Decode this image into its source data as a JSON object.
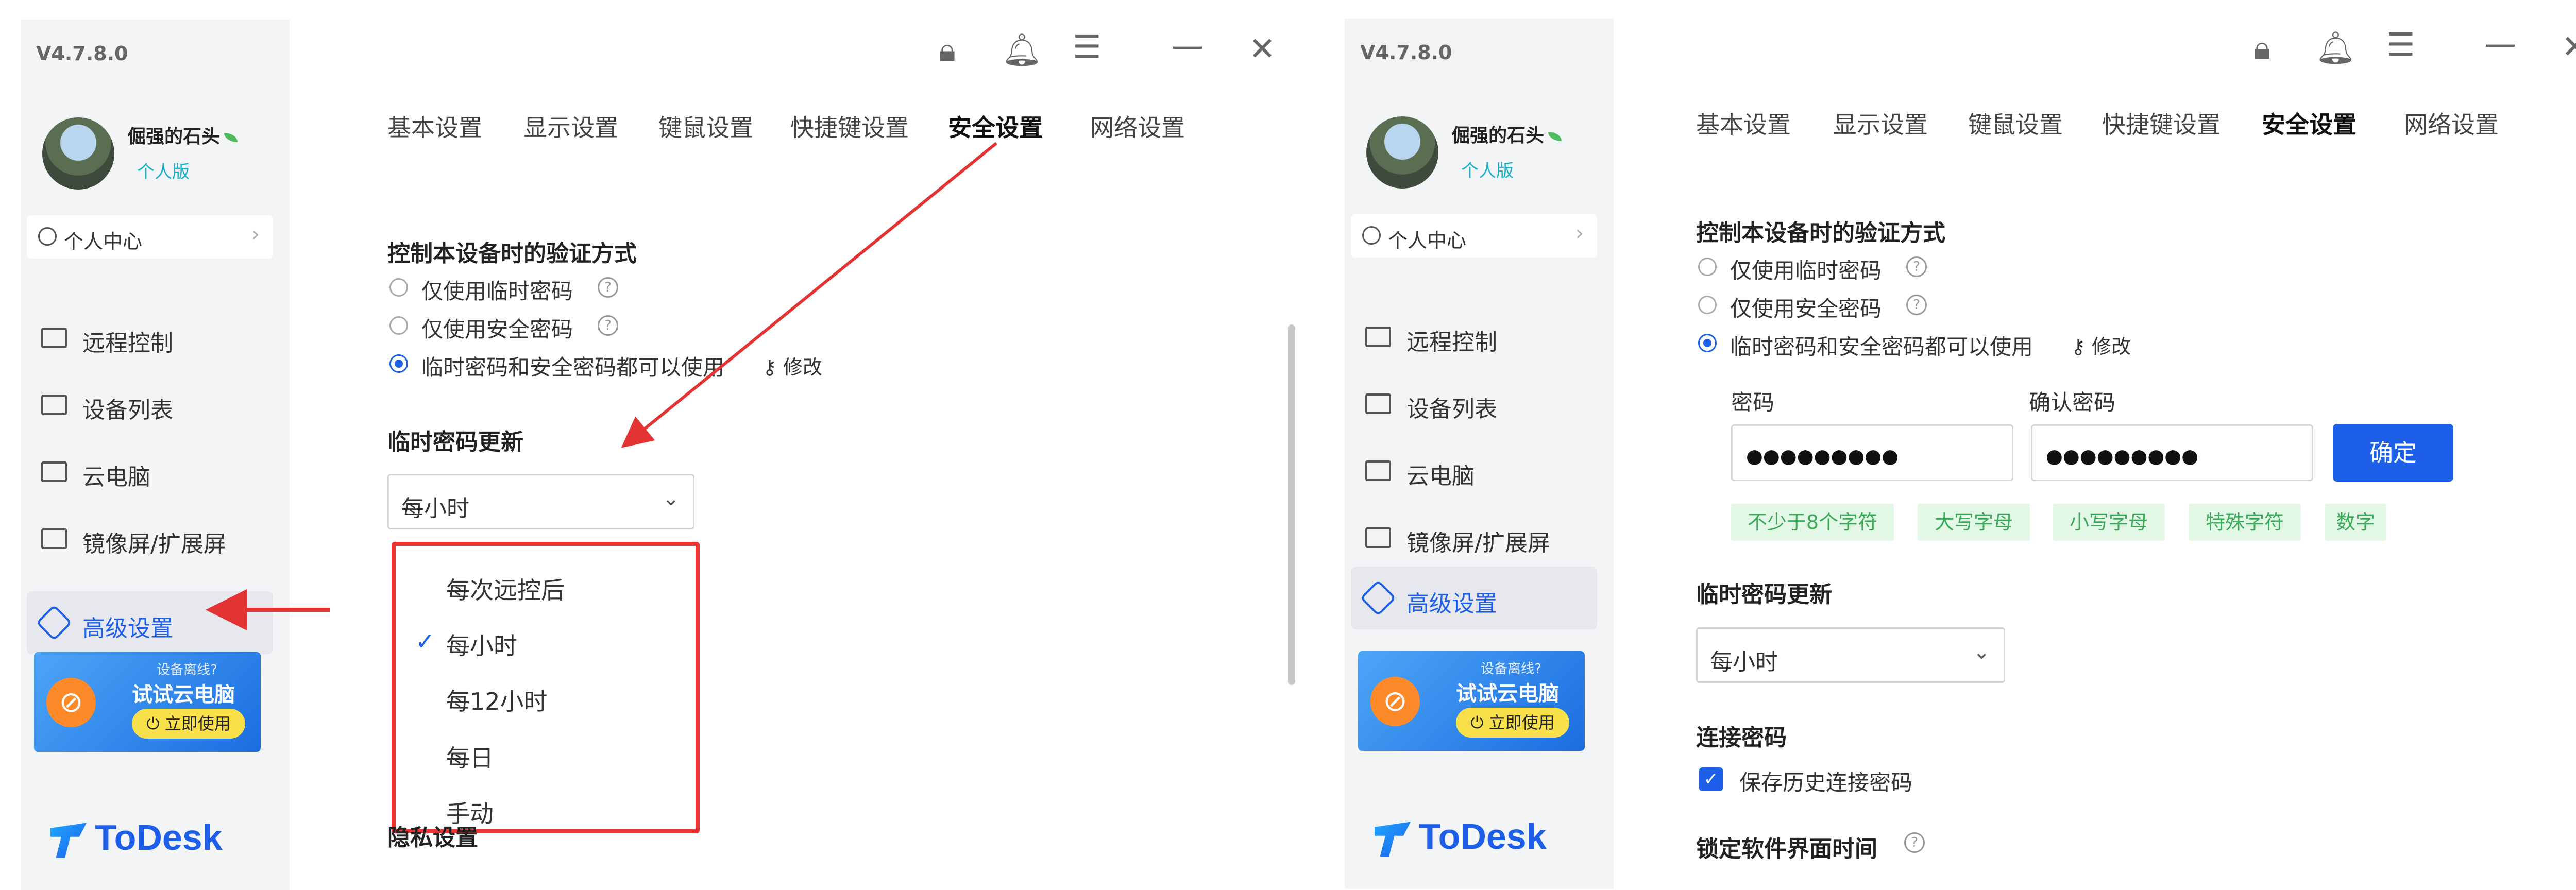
{
  "version": "V4.7.8.0",
  "user": {
    "name": "倔强的石头",
    "plan": "个人版"
  },
  "personal_center": "个人中心",
  "nav": [
    {
      "label": "远程控制"
    },
    {
      "label": "设备列表"
    },
    {
      "label": "云电脑"
    },
    {
      "label": "镜像屏/扩展屏"
    },
    {
      "label": "高级设置"
    }
  ],
  "promo": {
    "line1": "设备离线?",
    "line2": "试试云电脑",
    "button": "立即使用"
  },
  "logo": "ToDesk",
  "tabs": [
    "基本设置",
    "显示设置",
    "键鼠设置",
    "快捷键设置",
    "安全设置",
    "网络设置"
  ],
  "active_tab": "安全设置",
  "security": {
    "verify_title": "控制本设备时的验证方式",
    "options": [
      "仅使用临时密码",
      "仅使用安全密码",
      "临时密码和安全密码都可以使用"
    ],
    "modify": "修改",
    "temp_update_title": "临时密码更新",
    "temp_update_value": "每小时",
    "privacy_title": "隐私设置"
  },
  "dropdown": {
    "items": [
      "每次远控后",
      "每小时",
      "每12小时",
      "每日",
      "手动"
    ],
    "selected": "每小时"
  },
  "password_form": {
    "password_label": "密码",
    "confirm_label": "确认密码",
    "password_value": "●●●●●●●●●",
    "confirm_value": "●●●●●●●●●",
    "ok": "确定",
    "rules": [
      "不少于8个字符",
      "大写字母",
      "小写字母",
      "特殊字符",
      "数字"
    ]
  },
  "connection": {
    "title": "连接密码",
    "save_history": "保存历史连接密码",
    "lock_title": "锁定软件界面时间"
  },
  "colors": {
    "accent": "#1d5fe8",
    "annotation": "#e33333",
    "chip_bg": "#e2f7e6",
    "chip_text": "#3aa95a"
  }
}
